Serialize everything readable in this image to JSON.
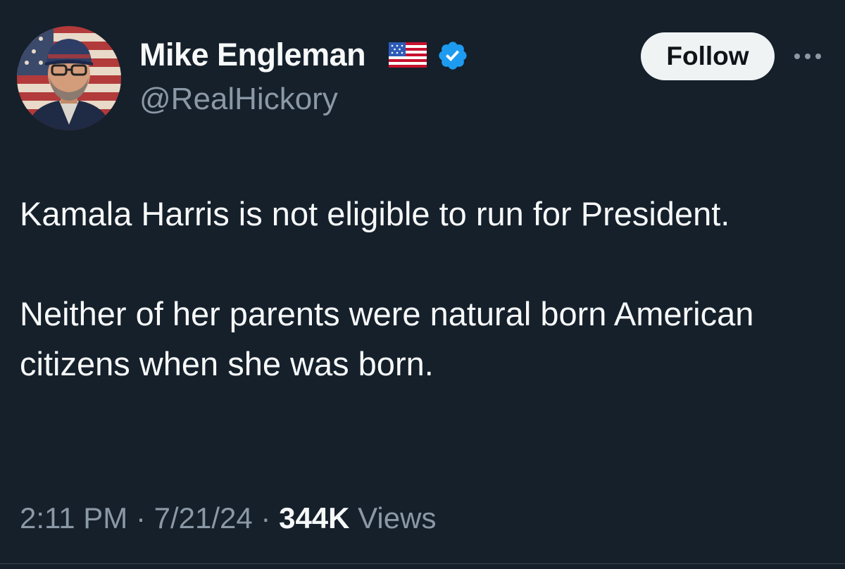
{
  "user": {
    "display_name": "Mike Engleman",
    "flag_icon": "us-flag-icon",
    "verified_icon": "verified-badge-icon",
    "handle": "@RealHickory"
  },
  "actions": {
    "follow_label": "Follow",
    "more_icon": "more-dots-icon"
  },
  "tweet": {
    "paragraphs": [
      "Kamala Harris is not eligible to run for President.",
      "Neither of her parents were natural born American citizens when she was born."
    ]
  },
  "meta": {
    "time": "2:11 PM",
    "separator": " · ",
    "date": "7/21/24",
    "views_count": "344K",
    "views_label": " Views"
  },
  "colors": {
    "background": "#15202b",
    "text": "#f7f9f9",
    "secondary_text": "#8b98a5",
    "verified_blue": "#1d9bf0",
    "follow_bg": "#eff3f4"
  }
}
